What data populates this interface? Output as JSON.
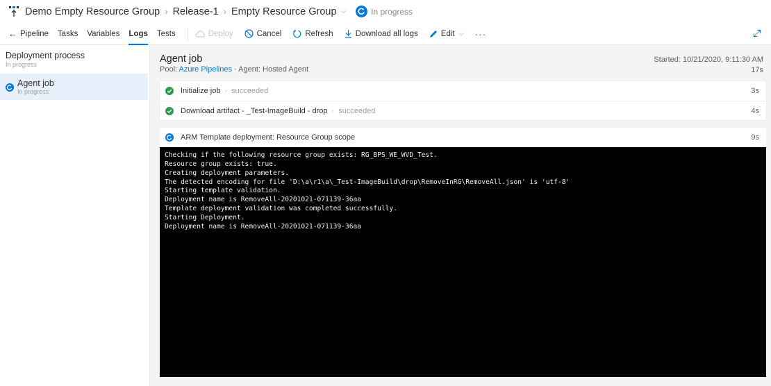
{
  "header": {
    "breadcrumbs": [
      "Demo Empty Resource Group",
      "Release-1",
      "Empty Resource Group"
    ],
    "status": "In progress",
    "icons": {
      "app": "release-pipeline-icon",
      "separator": "chevron-right-icon",
      "dropdown": "chevron-down-icon",
      "status": "in-progress-icon"
    }
  },
  "toolbar": {
    "back_label": "Pipeline",
    "tabs": [
      "Tasks",
      "Variables",
      "Logs",
      "Tests"
    ],
    "active_tab": "Logs",
    "deploy_label": "Deploy",
    "cancel_label": "Cancel",
    "refresh_label": "Refresh",
    "download_label": "Download all logs",
    "edit_label": "Edit",
    "more_label": "···"
  },
  "sidebar": {
    "section_title": "Deployment process",
    "section_status": "In progress",
    "items": [
      {
        "title": "Agent job",
        "status": "In progress",
        "selected": true
      }
    ]
  },
  "job": {
    "title": "Agent job",
    "pool_label": "Pool:",
    "pool_name": "Azure Pipelines",
    "agent_text": "· Agent: Hosted Agent",
    "started": "Started: 10/21/2020, 9:11:30 AM",
    "duration": "17s",
    "steps": [
      {
        "name": "Initialize job",
        "status": "succeeded",
        "duration": "3s"
      },
      {
        "name": "Download artifact - _Test-ImageBuild - drop",
        "status": "succeeded",
        "duration": "4s"
      }
    ],
    "running_step": {
      "name": "ARM Template deployment: Resource Group scope",
      "duration": "9s"
    },
    "log_lines": [
      "Checking if the following resource group exists: RG_BPS_WE_WVD_Test.",
      "Resource group exists: true.",
      "Creating deployment parameters.",
      "The detected encoding for file 'D:\\a\\r1\\a\\_Test-ImageBuild\\drop\\RemoveInRG\\RemoveAll.json' is 'utf-8'",
      "Starting template validation.",
      "Deployment name is RemoveAll-20201021-071139-36aa",
      "Template deployment validation was completed successfully.",
      "Starting Deployment.",
      "Deployment name is RemoveAll-20201021-071139-36aa"
    ]
  },
  "colors": {
    "accent": "#0078d4",
    "success": "#2e9b4f",
    "console_bg": "#000000"
  }
}
